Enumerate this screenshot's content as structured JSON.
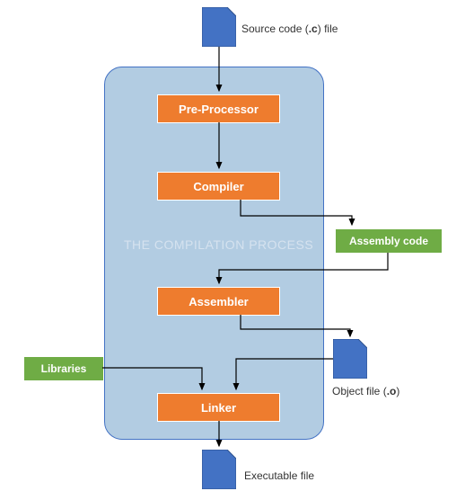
{
  "title_background": "THE COMPILATION PROCESS",
  "files": {
    "source": {
      "label": "Source code (.c) file"
    },
    "object": {
      "label": "Object file (.o)"
    },
    "executable": {
      "label": "Executable file"
    }
  },
  "stages": {
    "preprocessor": "Pre-Processor",
    "compiler": "Compiler",
    "assembler": "Assembler",
    "linker": "Linker"
  },
  "aux": {
    "assembly_code": "Assembly code",
    "libraries": "Libraries"
  },
  "chart_data": {
    "type": "flow",
    "nodes": [
      {
        "id": "source",
        "kind": "file",
        "label": "Source code (.c) file"
      },
      {
        "id": "preprocessor",
        "kind": "stage",
        "label": "Pre-Processor"
      },
      {
        "id": "compiler",
        "kind": "stage",
        "label": "Compiler"
      },
      {
        "id": "assembly",
        "kind": "aux",
        "label": "Assembly code"
      },
      {
        "id": "assembler",
        "kind": "stage",
        "label": "Assembler"
      },
      {
        "id": "object",
        "kind": "file",
        "label": "Object file (.o)"
      },
      {
        "id": "libraries",
        "kind": "aux",
        "label": "Libraries"
      },
      {
        "id": "linker",
        "kind": "stage",
        "label": "Linker"
      },
      {
        "id": "executable",
        "kind": "file",
        "label": "Executable file"
      }
    ],
    "edges": [
      [
        "source",
        "preprocessor"
      ],
      [
        "preprocessor",
        "compiler"
      ],
      [
        "compiler",
        "assembly"
      ],
      [
        "assembly",
        "assembler"
      ],
      [
        "assembler",
        "object"
      ],
      [
        "object",
        "linker"
      ],
      [
        "libraries",
        "linker"
      ],
      [
        "linker",
        "executable"
      ]
    ],
    "container_label": "THE COMPILATION PROCESS"
  }
}
